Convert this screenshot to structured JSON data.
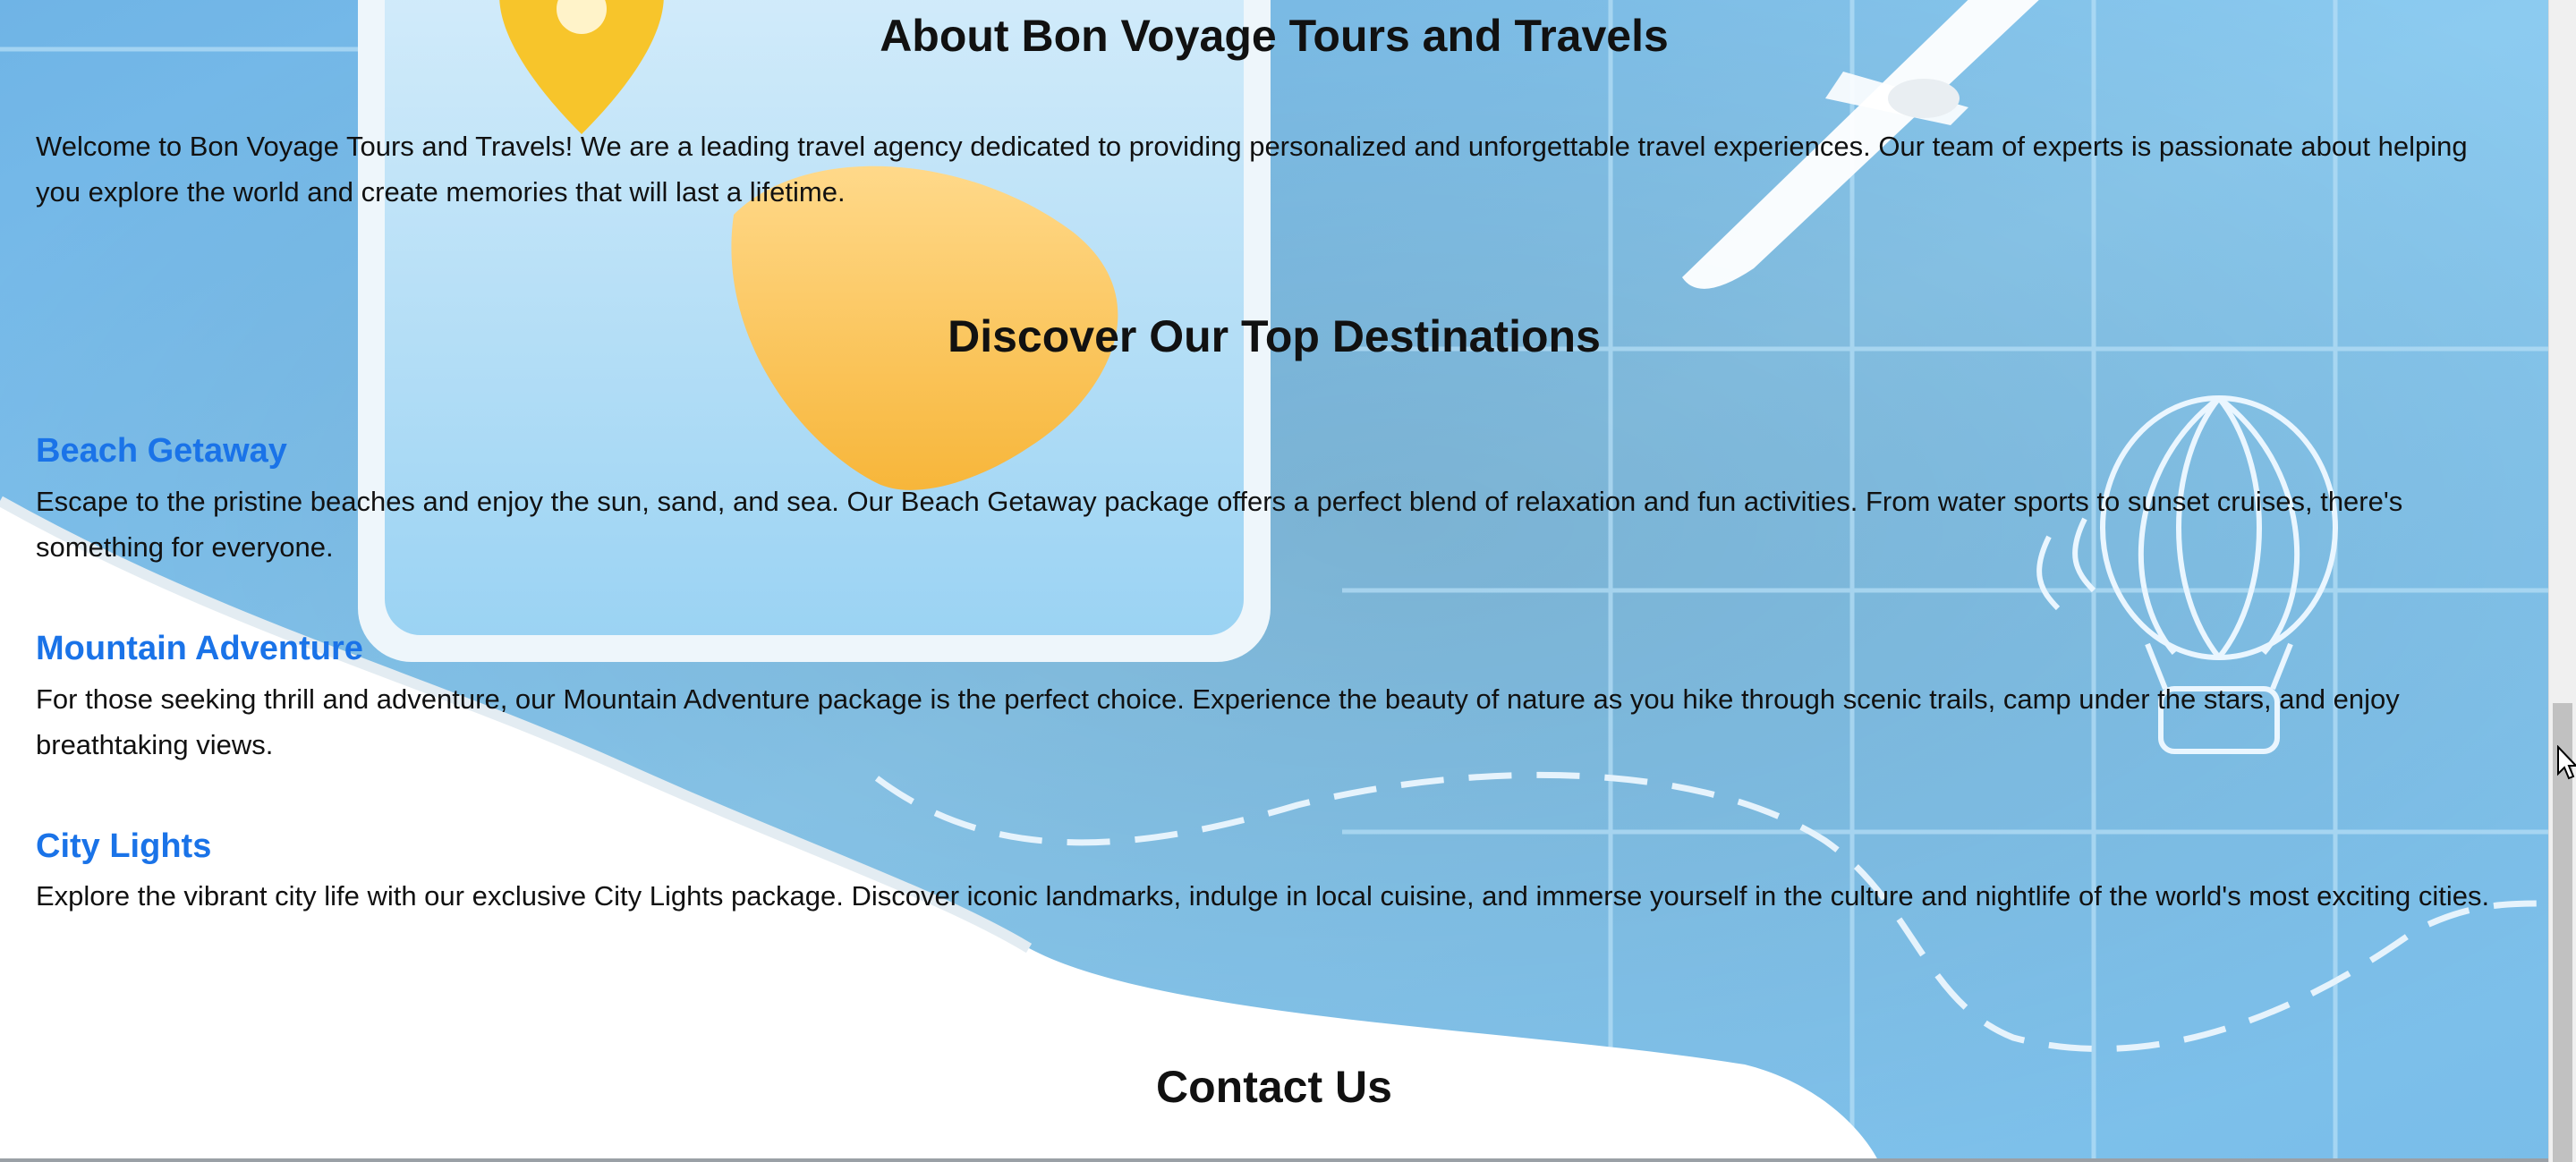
{
  "about": {
    "heading": "About Bon Voyage Tours and Travels",
    "text": "Welcome to Bon Voyage Tours and Travels! We are a leading travel agency dedicated to providing personalized and unforgettable travel experiences. Our team of experts is passionate about helping you explore the world and create memories that will last a lifetime."
  },
  "destinations": {
    "heading": "Discover Our Top Destinations",
    "items": [
      {
        "title": "Beach Getaway",
        "description": "Escape to the pristine beaches and enjoy the sun, sand, and sea. Our Beach Getaway package offers a perfect blend of relaxation and fun activities. From water sports to sunset cruises, there's something for everyone."
      },
      {
        "title": "Mountain Adventure",
        "description": "For those seeking thrill and adventure, our Mountain Adventure package is the perfect choice. Experience the beauty of nature as you hike through scenic trails, camp under the stars, and enjoy breathtaking views."
      },
      {
        "title": "City Lights",
        "description": "Explore the vibrant city life with our exclusive City Lights package. Discover iconic landmarks, indulge in local cuisine, and immerse yourself in the culture and nightlife of the world's most exciting cities."
      }
    ]
  },
  "contact": {
    "heading": "Contact Us"
  },
  "colors": {
    "link": "#1a73e8",
    "background_blue": "#8ec8ee",
    "pin_yellow": "#f7c52b",
    "text": "#111111"
  },
  "icons": [
    "map-pin-icon",
    "airplane-icon",
    "hot-air-balloon-icon",
    "mouse-cursor-icon"
  ]
}
